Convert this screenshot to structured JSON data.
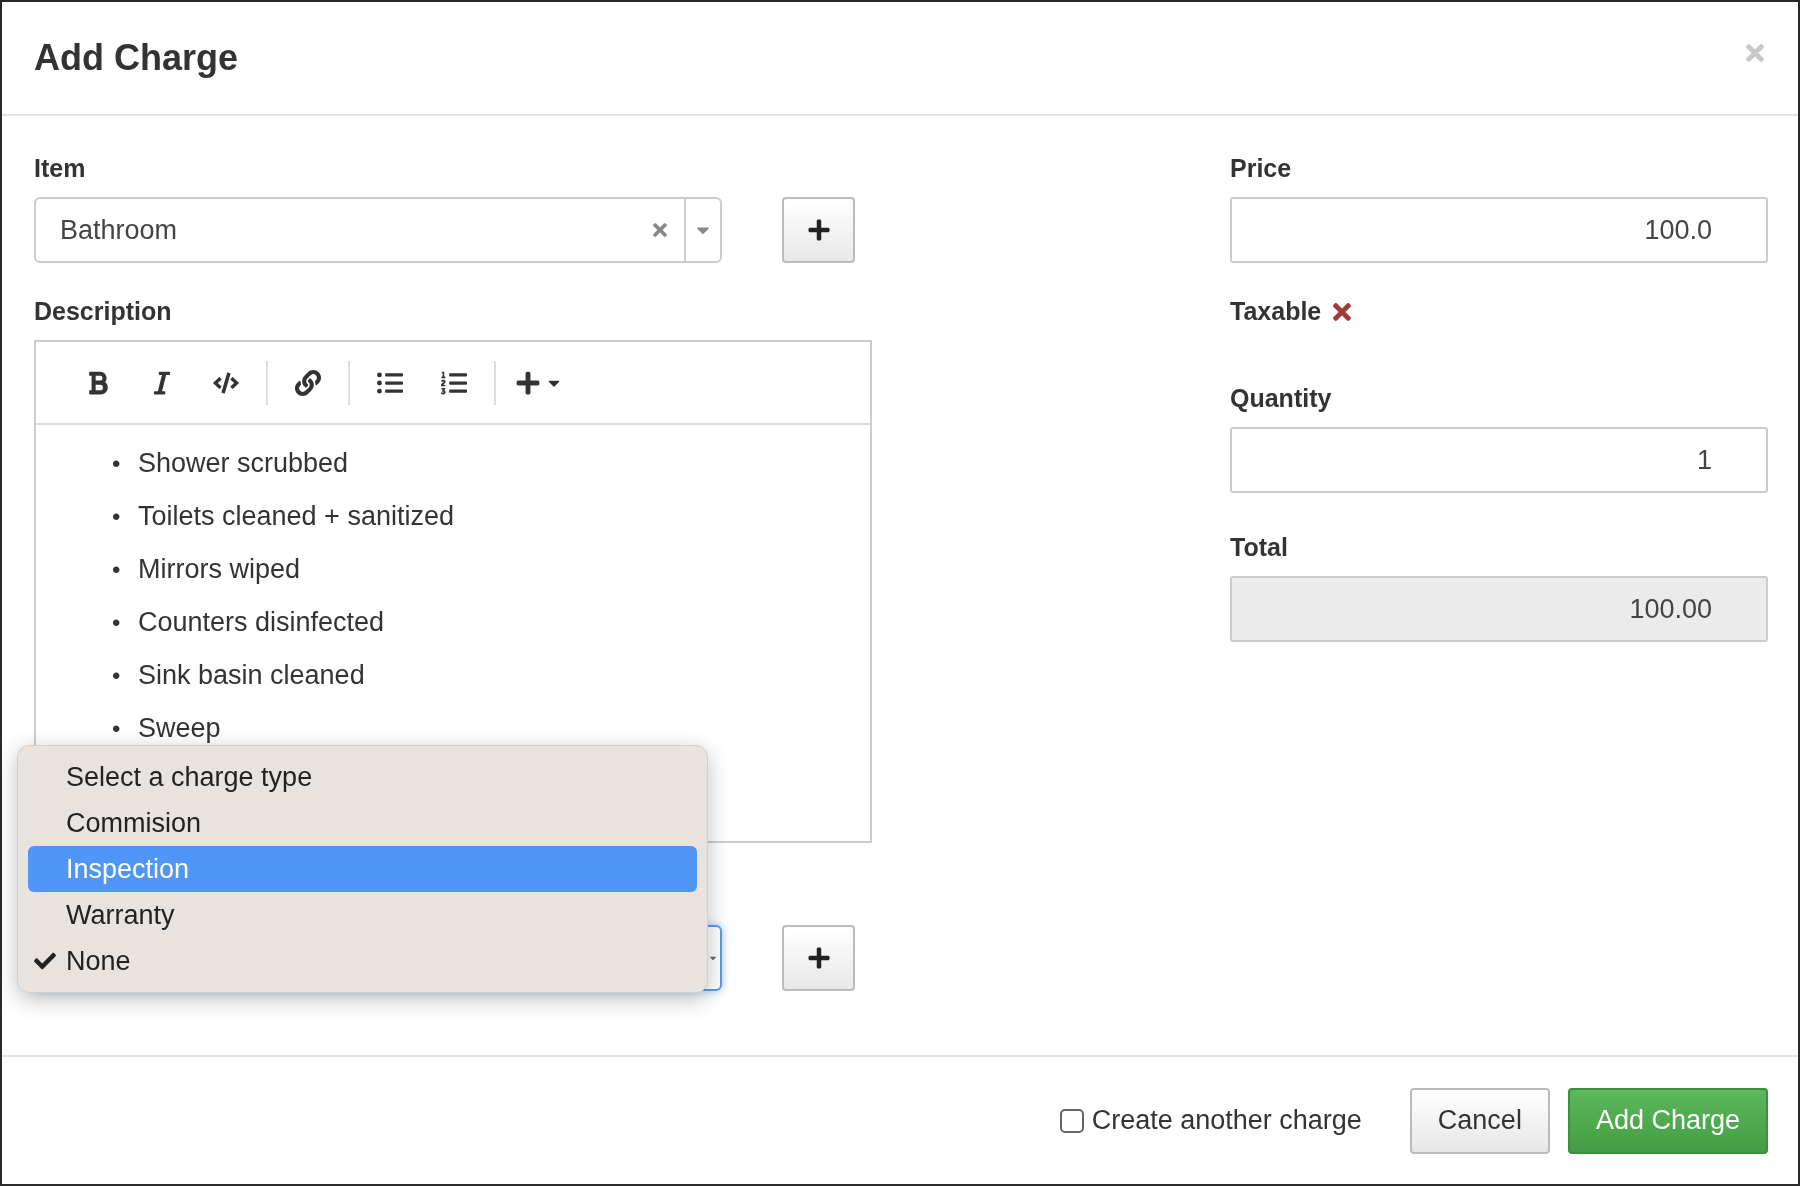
{
  "dialog": {
    "title": "Add Charge"
  },
  "item": {
    "label": "Item",
    "value": "Bathroom"
  },
  "description": {
    "label": "Description",
    "items": [
      {
        "marker": "•",
        "text": "Shower scrubbed"
      },
      {
        "marker": "•",
        "text": "Toilets cleaned + sanitized"
      },
      {
        "marker": "•",
        "text": "Mirrors wiped"
      },
      {
        "marker": "•",
        "text": "Counters disinfected"
      },
      {
        "marker": "•",
        "text": "Sink basin cleaned"
      },
      {
        "marker": "•",
        "text": "Sweep"
      }
    ]
  },
  "charge_type": {
    "options": [
      {
        "label": "Select a charge type",
        "selected": false,
        "checked": false
      },
      {
        "label": "Commision",
        "selected": false,
        "checked": false
      },
      {
        "label": "Inspection",
        "selected": true,
        "checked": false
      },
      {
        "label": "Warranty",
        "selected": false,
        "checked": false
      },
      {
        "label": "None",
        "selected": false,
        "checked": true
      }
    ]
  },
  "price": {
    "label": "Price",
    "value": "100.0"
  },
  "taxable": {
    "label": "Taxable",
    "checked": false
  },
  "quantity": {
    "label": "Quantity",
    "value": "1"
  },
  "total": {
    "label": "Total",
    "value": "100.00",
    "disabled": true
  },
  "footer": {
    "create_another": {
      "label": "Create another charge",
      "checked": false
    },
    "buttons": [
      {
        "label": "Cancel",
        "kind": "default"
      },
      {
        "label": "Add Charge",
        "kind": "primary"
      }
    ]
  }
}
